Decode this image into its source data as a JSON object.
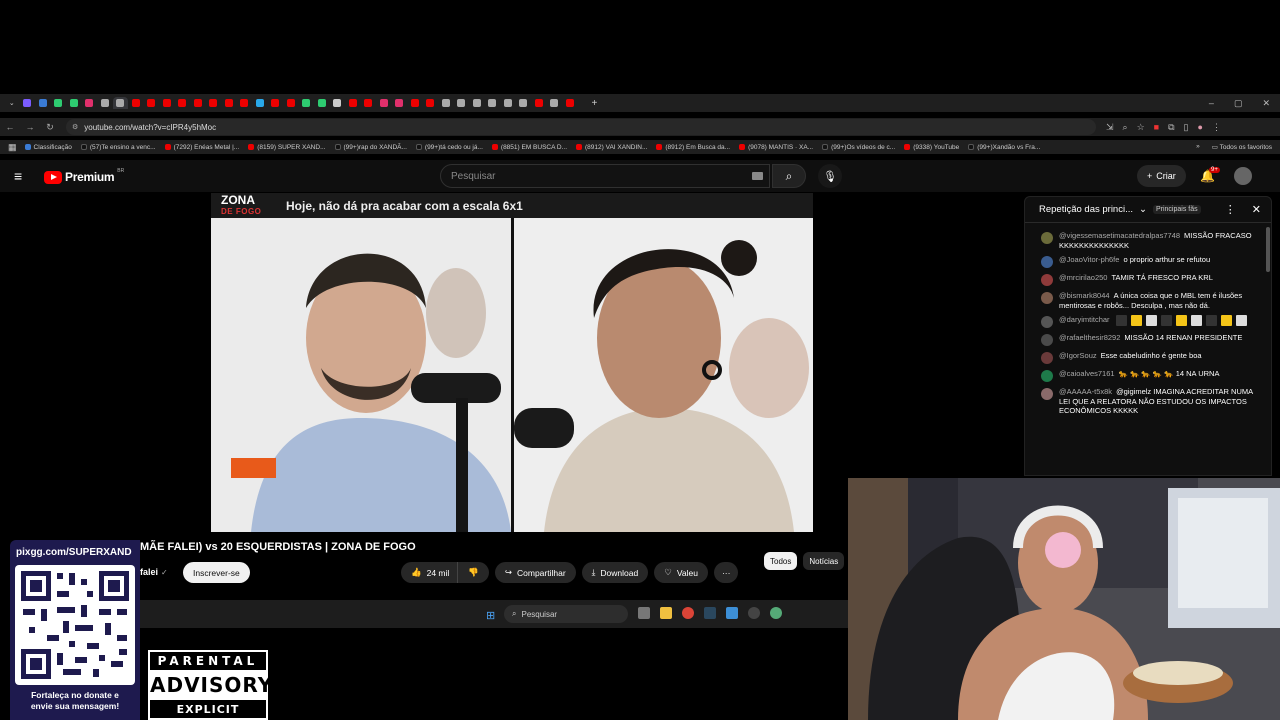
{
  "browser": {
    "url": "youtube.com/watch?v=cIPR4y5hMoc",
    "new_tab": "+",
    "win_min": "–",
    "win_max": "▢",
    "win_close": "✕",
    "tab_colors": [
      "#7b5cff",
      "#3a7bd5",
      "#2ecc71",
      "#2ecc71",
      "#e1306c",
      "#aaaaaa",
      "#aaaaaa",
      "#e00",
      "#e00",
      "#e00",
      "#e00",
      "#e00",
      "#e00",
      "#e00",
      "#e00",
      "#29a9eb",
      "#e00",
      "#e00",
      "#2ecc71",
      "#2ecc71",
      "#cccccc",
      "#e00",
      "#e00",
      "#e1306c",
      "#e1306c",
      "#e00",
      "#e00",
      "#aaaaaa",
      "#aaaaaa",
      "#aaaaaa",
      "#aaaaaa",
      "#aaaaaa",
      "#aaaaaa",
      "#e00",
      "#aaaaaa",
      "#e00"
    ],
    "bookmarks": [
      {
        "label": "Classificação",
        "kind": "bl"
      },
      {
        "label": "(57)Te ensino a venc...",
        "kind": "tt"
      },
      {
        "label": "(7292) Enéas Metal |...",
        "kind": "yt"
      },
      {
        "label": "(8159) SUPER XAND...",
        "kind": "yt"
      },
      {
        "label": "(99+)rap do XANDÃ...",
        "kind": "tt"
      },
      {
        "label": "(99+)tá cedo ou já...",
        "kind": "tt"
      },
      {
        "label": "(8851) EM BUSCA D...",
        "kind": "yt"
      },
      {
        "label": "(8912) VAI XANDIN...",
        "kind": "yt"
      },
      {
        "label": "(8912) Em Busca da...",
        "kind": "yt"
      },
      {
        "label": "(9078) MANTIS · XA...",
        "kind": "yt"
      },
      {
        "label": "(99+)Os vídeos de c...",
        "kind": "tt"
      },
      {
        "label": "(9338) YouTube",
        "kind": "yt"
      },
      {
        "label": "(99+)Xandão vs Fra...",
        "kind": "tt"
      }
    ],
    "bookmarks_more": "»",
    "all_favorites": "Todos os favoritos"
  },
  "youtube": {
    "brand": "Premium",
    "region": "BR",
    "search_placeholder": "Pesquisar",
    "create_label": "Criar",
    "notif_count": "9+"
  },
  "video": {
    "banner_logo_top": "ZONA",
    "banner_logo_bottom": "DE FOGO",
    "banner_caption": "Hoje, não dá pra acabar com a escala 6x1",
    "title_fragment": "MÃE FALEI) vs 20 ESQUERDISTAS | ZONA DE FOGO",
    "channel_fragment": "falei",
    "subscribe_label": "Inscrever-se",
    "likes": "24 mil",
    "share_label": "Compartilhar",
    "download_label": "Download",
    "thanks_label": "Valeu",
    "more_label": "···"
  },
  "chips": [
    "Todos",
    "Notícias"
  ],
  "chat": {
    "title": "Repetição das princi...",
    "fans_filter": "Principais fãs",
    "messages": [
      {
        "author": "@vigessemasetimacatedralpas7748",
        "text": "MISSÃO FRACASO KKKKKKKKKKKKKK",
        "color": "#6b6b3a"
      },
      {
        "author": "@JoaoVitor-ph6fe",
        "text": "o proprio arthur se refutou",
        "color": "#3a5c8f"
      },
      {
        "author": "@mrcirilao250",
        "text": "TAMIR TÁ FRESCO PRA KRL",
        "color": "#8f3a3a"
      },
      {
        "author": "@bismark8044",
        "text": "A única coisa que o MBL tem é ilusões mentirosas e robôs... Desculpa , mas não dá.",
        "color": "#7a5a4a"
      },
      {
        "author": "@daryimtitchar",
        "text": "",
        "color": "#555555",
        "emoji": true
      },
      {
        "author": "@rafaelthesir8292",
        "text": "MISSÃO 14 RENAN PRESIDENTE",
        "color": "#4a4a4a"
      },
      {
        "author": "@IgorSouz",
        "text": "Esse cabeludinho é gente boa",
        "color": "#6a3a3a"
      },
      {
        "author": "@caioalves7161",
        "text": "🐆 🐆 🐆 🐆 🐆 14 NA URNA",
        "color": "#1e7a4a"
      },
      {
        "author": "@AAAAA-t5x8k",
        "text": "@gigimelz IMAGINA ACREDITAR NUMA LEI QUE A RELATORA NÃO ESTUDOU OS IMPACTOS ECONÔMICOS KKKKK",
        "color": "#8a6a6a"
      }
    ]
  },
  "taskbar": {
    "search_placeholder": "Pesquisar"
  },
  "overlay": {
    "donate_url": "pixgg.com/SUPERXAND",
    "donate_message_line1": "Fortaleça no donate e",
    "donate_message_line2": "envie sua mensagem!",
    "advisory_top": "PARENTAL",
    "advisory_mid": "ADVISORY",
    "advisory_bottom": "EXPLICIT CONTENT"
  }
}
